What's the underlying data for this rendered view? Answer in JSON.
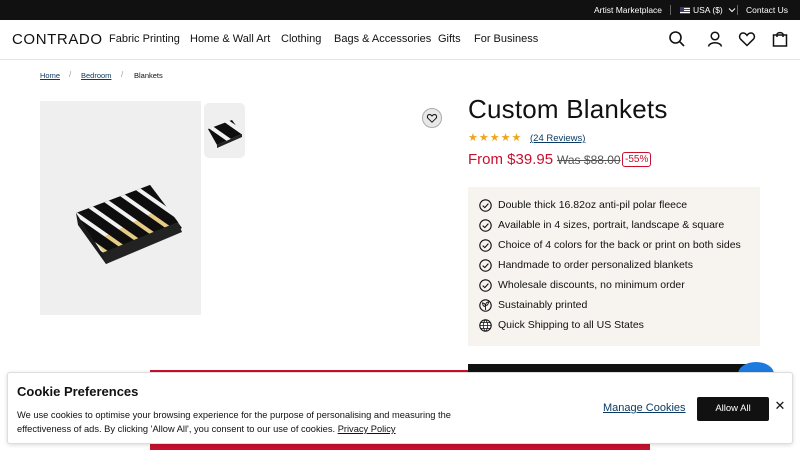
{
  "topbar": {
    "artist_marketplace": "Artist Marketplace",
    "currency": "USA ($)",
    "contact": "Contact Us"
  },
  "header": {
    "logo": "CONTRADO",
    "nav": [
      "Fabric Printing",
      "Home & Wall Art",
      "Clothing",
      "Bags & Accessories",
      "Gifts",
      "For Business"
    ],
    "icons": [
      "search-icon",
      "account-icon",
      "heart-icon",
      "bag-icon"
    ]
  },
  "breadcrumb": {
    "items": [
      "Home",
      "Bedroom",
      "Blankets"
    ],
    "separator": "/"
  },
  "product": {
    "title": "Custom Blankets",
    "stars": "★★★★★",
    "reviews": "(24 Reviews)",
    "price_from": "From $39.95",
    "price_was": "Was $88.00",
    "discount": "-55%",
    "features": [
      "Double thick 16.82oz anti-pil polar fleece",
      "Available in 4 sizes, portrait, landscape & square",
      "Choice of 4 colors for the back or print on both sides",
      "Handmade to order personalized blankets",
      "Wholesale discounts, no minimum order",
      "Sustainably printed",
      "Quick Shipping to all US States"
    ],
    "feature_icons": [
      "check-circle-icon",
      "check-circle-icon",
      "check-circle-icon",
      "check-circle-icon",
      "check-circle-icon",
      "leaf-icon",
      "globe-icon"
    ]
  },
  "cookie": {
    "title": "Cookie Preferences",
    "text": "We use cookies to optimise your browsing experience for the purpose of personalising and measuring the effectiveness of ads. By clicking 'Allow All', you consent to our use of cookies.",
    "policy_link": "Privacy Policy",
    "manage": "Manage Cookies",
    "allow": "Allow All",
    "close": "✕"
  },
  "colors": {
    "accent_red": "#c8102e",
    "star": "#f0a419",
    "feature_bg": "#f7f3ee",
    "link_blue": "#0b3b63"
  }
}
